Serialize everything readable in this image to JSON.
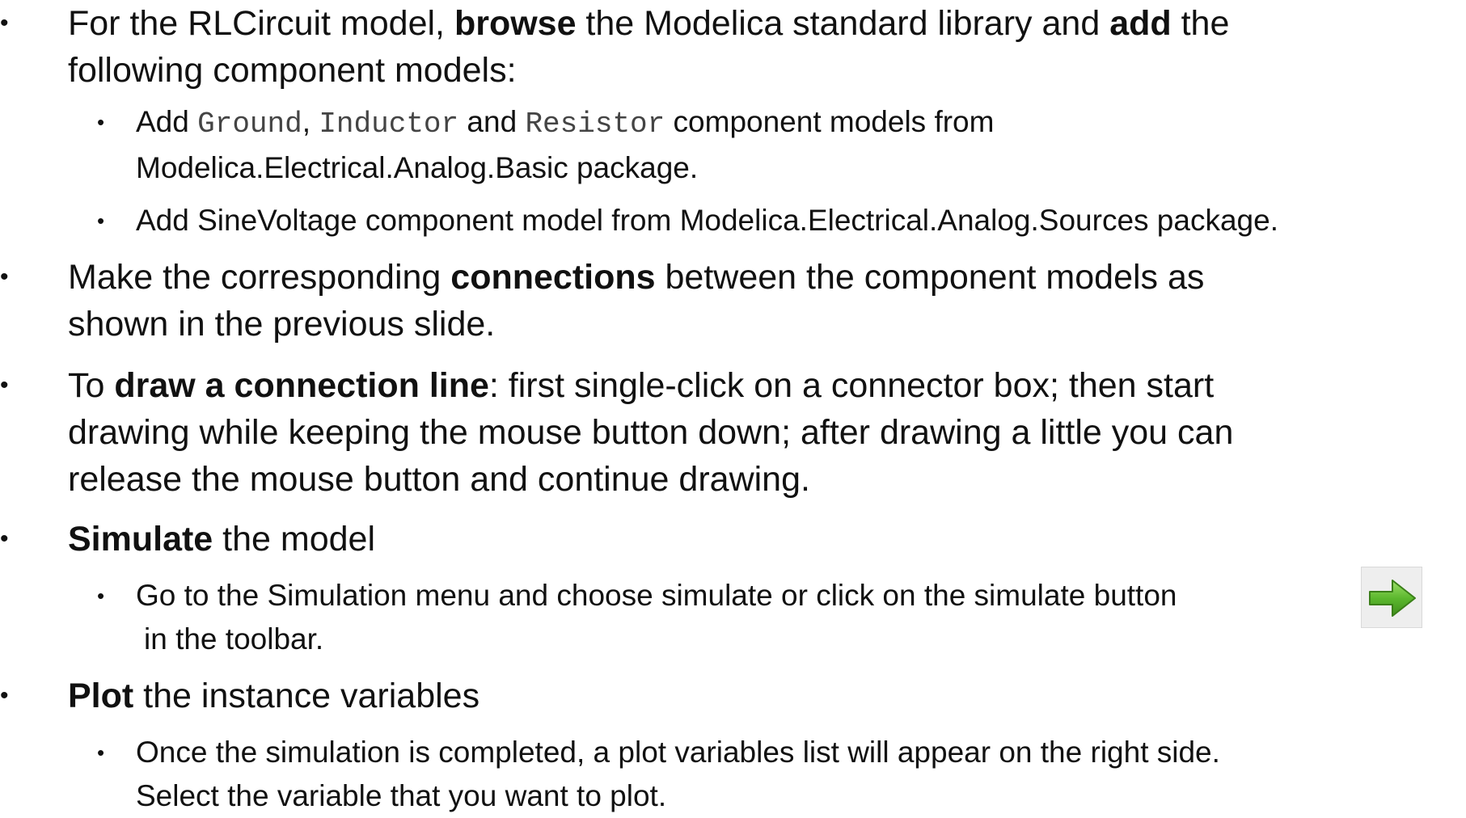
{
  "b1": {
    "pre": "For the RLCircuit model, ",
    "bold1": "browse",
    "mid": " the Modelica standard library and ",
    "bold2": "add",
    "post": " the",
    "line2": "following component models:"
  },
  "b1_1": {
    "pre": "Add ",
    "code1": "Ground",
    "sep1": ", ",
    "code2": "Inductor",
    "sep2": " and ",
    "code3": "Resistor",
    "post": " component models from",
    "line2": "Modelica.Electrical.Analog.Basic package."
  },
  "b1_2": {
    "text": "Add SineVoltage component model from Modelica.Electrical.Analog.Sources package."
  },
  "b2": {
    "pre": "Make the corresponding ",
    "bold": "connections",
    "post": " between the component models as",
    "line2": "shown in the previous slide."
  },
  "b3": {
    "pre": "To ",
    "bold": "draw a connection line",
    "post": ": first single-click on a connector box; then start",
    "line2": "drawing while keeping the mouse button down; after drawing a little you can",
    "line3": "release the mouse button and continue drawing."
  },
  "b4": {
    "bold": "Simulate",
    "post": " the model"
  },
  "b4_1": {
    "line1": "Go to the Simulation menu and choose simulate or click on the simulate button",
    "line2": "in the toolbar."
  },
  "b5": {
    "bold": "Plot",
    "post": " the instance variables"
  },
  "b5_1": {
    "line1": "Once the simulation is completed, a plot variables list will appear on the right side.",
    "line2": "Select the variable that you want to plot."
  },
  "bullet_l1": "•",
  "bullet_l2": "•",
  "icons": {
    "simulate": "green-right-arrow-icon"
  },
  "colors": {
    "text": "#111111",
    "code": "#444444",
    "arrow_green": "#5cb82e"
  }
}
